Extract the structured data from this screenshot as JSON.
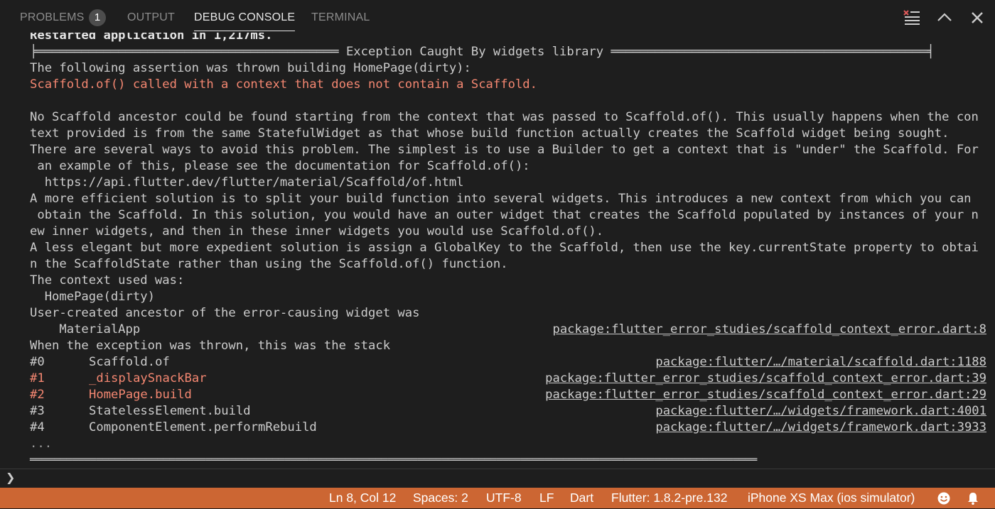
{
  "panel": {
    "tabs": [
      {
        "label": "PROBLEMS",
        "badge": "1"
      },
      {
        "label": "OUTPUT"
      },
      {
        "label": "DEBUG CONSOLE"
      },
      {
        "label": "TERMINAL"
      }
    ],
    "actions": [
      "clear-console-icon",
      "chevron-up-icon",
      "close-icon"
    ]
  },
  "console": {
    "restarted": "Restarted application in 1,217ms.",
    "header": "╞═════════════════════════════════════════ Exception Caught By widgets library ═══════════════════════════════════════════╡",
    "lines": [
      "The following assertion was thrown building HomePage(dirty):",
      "Scaffold.of() called with a context that does not contain a Scaffold.",
      "",
      "No Scaffold ancestor could be found starting from the context that was passed to Scaffold.of(). This usually happens when the con",
      "text provided is from the same StatefulWidget as that whose build function actually creates the Scaffold widget being sought.",
      "There are several ways to avoid this problem. The simplest is to use a Builder to get a context that is \"under\" the Scaffold. For",
      " an example of this, please see the documentation for Scaffold.of():",
      "  https://api.flutter.dev/flutter/material/Scaffold/of.html",
      "A more efficient solution is to split your build function into several widgets. This introduces a new context from which you can",
      " obtain the Scaffold. In this solution, you would have an outer widget that creates the Scaffold populated by instances of your n",
      "ew inner widgets, and then in these inner widgets you would use Scaffold.of().",
      "A less elegant but more expedient solution is assign a GlobalKey to the Scaffold, then use the key.currentState property to obtai",
      "n the ScaffoldState rather than using the Scaffold.of() function.",
      "The context used was:",
      "  HomePage(dirty)",
      "User-created ancestor of the error-causing widget was"
    ],
    "ancestor": {
      "name": "    MaterialApp",
      "link": "package:flutter_error_studies/scaffold_context_error.dart:8"
    },
    "stack_intro": "When the exception was thrown, this was the stack",
    "frames": [
      {
        "num": "#0",
        "fn": "Scaffold.of",
        "link": "package:flutter/…/material/scaffold.dart:1188",
        "user": false
      },
      {
        "num": "#1",
        "fn": "_displaySnackBar",
        "link": "package:flutter_error_studies/scaffold_context_error.dart:39",
        "user": true
      },
      {
        "num": "#2",
        "fn": "HomePage.build",
        "link": "package:flutter_error_studies/scaffold_context_error.dart:29",
        "user": true
      },
      {
        "num": "#3",
        "fn": "StatelessElement.build",
        "link": "package:flutter/…/widgets/framework.dart:4001",
        "user": false
      },
      {
        "num": "#4",
        "fn": "ComponentElement.performRebuild",
        "link": "package:flutter/…/widgets/framework.dart:3933",
        "user": false
      }
    ],
    "ellipsis": "...",
    "footer": "════════════════════════════════════════════════════════════════════════════════════════════════════════════════════════"
  },
  "input": {
    "prompt": "❯",
    "value": ""
  },
  "statusbar": {
    "position": "Ln 8, Col 12",
    "spaces": "Spaces: 2",
    "encoding": "UTF-8",
    "eol": "LF",
    "language": "Dart",
    "flutter": "Flutter: 1.8.2-pre.132",
    "device": "iPhone XS Max (ios simulator)",
    "icons": [
      "smiley-feedback-icon",
      "bell-notification-icon"
    ]
  },
  "colors": {
    "background": "#1e1e1e",
    "error_text": "#f48771",
    "status_bar": "#cc6633"
  }
}
